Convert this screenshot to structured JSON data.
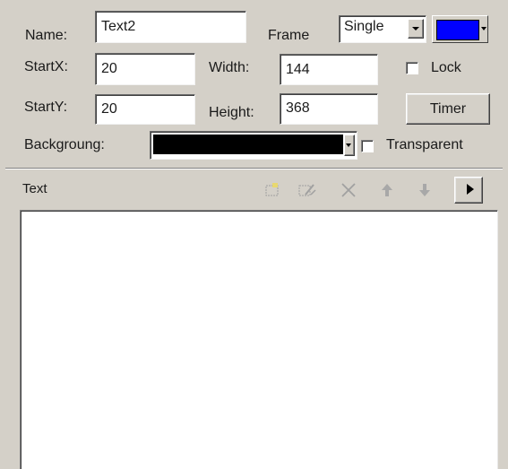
{
  "form": {
    "name_label": "Name:",
    "name_value": "Text2",
    "frame_label": "Frame",
    "frame_value": "Single",
    "frame_color": "#0000ff",
    "startx_label": "StartX:",
    "startx_value": "20",
    "width_label": "Width:",
    "width_value": "144",
    "lock_label": "Lock",
    "lock_checked": false,
    "starty_label": "StartY:",
    "starty_value": "20",
    "height_label": "Height:",
    "height_value": "368",
    "timer_label": "Timer",
    "background_label": "Backgroung:",
    "background_color": "#000000",
    "transparent_label": "Transparent",
    "transparent_checked": false
  },
  "text_section": {
    "title": "Text",
    "toolbar": [
      {
        "icon": "new-item-icon"
      },
      {
        "icon": "edit-item-icon"
      },
      {
        "icon": "delete-icon"
      },
      {
        "icon": "move-up-icon"
      },
      {
        "icon": "move-down-icon"
      },
      {
        "icon": "play-icon"
      }
    ],
    "content": ""
  }
}
